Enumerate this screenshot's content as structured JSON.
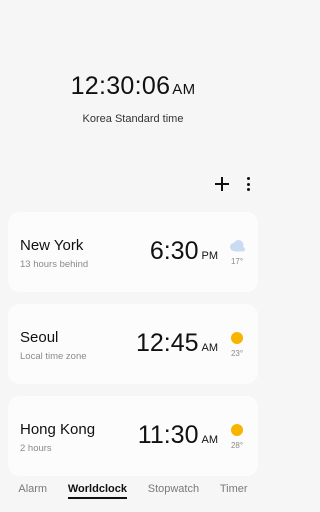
{
  "main_clock": {
    "time": "12:30:06",
    "ampm": "AM",
    "zone": "Korea Standard time"
  },
  "toolbar": {
    "add_icon": "plus-icon",
    "more_icon": "more-vertical-icon"
  },
  "cities": [
    {
      "name": "New York",
      "diff": "13 hours behind",
      "time": "6:30",
      "ampm": "PM",
      "weather": "partly-cloudy-icon",
      "temp": "17°"
    },
    {
      "name": "Seoul",
      "diff": "Local time zone",
      "time": "12:45",
      "ampm": "AM",
      "weather": "sun-icon",
      "temp": "23°"
    },
    {
      "name": "Hong Kong",
      "diff": "2 hours",
      "time": "11:30",
      "ampm": "AM",
      "weather": "sun-icon",
      "temp": "28°"
    }
  ],
  "tabs": {
    "alarm": "Alarm",
    "worldclock": "Worldclock",
    "stopwatch": "Stopwatch",
    "timer": "Timer",
    "active": "Worldclock"
  },
  "colors": {
    "background": "#f6f6f6",
    "card": "#fcfcfc",
    "sun": "#f7b500",
    "cloud": "#c9dcf2"
  }
}
